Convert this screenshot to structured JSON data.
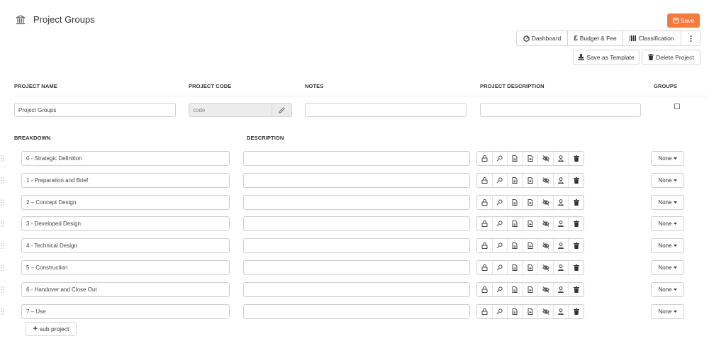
{
  "header": {
    "title": "Project Groups",
    "icon": "building-icon"
  },
  "toolbar": {
    "save_label": "Save",
    "dashboard_label": "Dashboard",
    "budget_label": "Budget & Fee",
    "classification_label": "Classification",
    "save_template_label": "Save as Template",
    "delete_label": "Delete Project"
  },
  "columns": {
    "project_name": "PROJECT NAME",
    "project_code": "PROJECT CODE",
    "notes": "NOTES",
    "project_description": "PROJECT DESCRIPTION",
    "groups": "GROUPS",
    "breakdown": "BREAKDOWN",
    "description": "DESCRIPTION"
  },
  "form": {
    "project_name_value": "Project Groups",
    "project_code_placeholder": "code",
    "notes_value": "",
    "project_description_value": "",
    "groups_checked": false
  },
  "rows": [
    {
      "name": "0 - Strategic Definition",
      "description": "",
      "select": "None"
    },
    {
      "name": "1 - Preparation and Brief",
      "description": "",
      "select": "None"
    },
    {
      "name": "2 – Concept Design",
      "description": "",
      "select": "None"
    },
    {
      "name": "3 - Developed Design",
      "description": "",
      "select": "None"
    },
    {
      "name": "4 - Technical Design",
      "description": "",
      "select": "None"
    },
    {
      "name": "5 – Construction",
      "description": "",
      "select": "None"
    },
    {
      "name": "6 - Handover and Close Out",
      "description": "",
      "select": "None"
    },
    {
      "name": "7 – Use",
      "description": "",
      "select": "None"
    }
  ],
  "row_icons": [
    "lock-icon",
    "key-icon",
    "document-icon",
    "document-plus-icon",
    "eye-off-icon",
    "user-icon",
    "trash-icon"
  ],
  "sub_project_label": "sub project",
  "colors": {
    "accent": "#f47b3e"
  }
}
